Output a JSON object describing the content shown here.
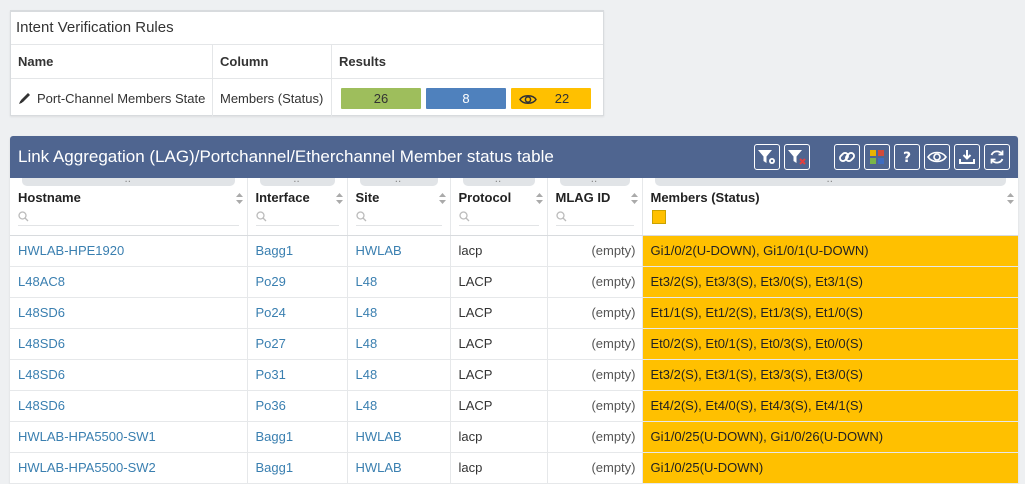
{
  "intent_rules": {
    "title": "Intent Verification Rules",
    "headers": {
      "name": "Name",
      "column": "Column",
      "results": "Results"
    },
    "rule": {
      "name": "Port-Channel Members State",
      "column": "Members (Status)",
      "results": {
        "green": "26",
        "blue": "8",
        "orange": "22"
      }
    }
  },
  "table": {
    "title": "Link Aggregation (LAG)/Portchannel/Etherchannel Member status table",
    "toolbar_icons": [
      "filter-settings-icon",
      "filter-clear-icon",
      "link-icon",
      "color-grid-icon",
      "help-icon",
      "eye-icon",
      "download-icon",
      "refresh-icon"
    ],
    "columns": [
      "Hostname",
      "Interface",
      "Site",
      "Protocol",
      "MLAG ID",
      "Members (Status)"
    ],
    "rows": [
      {
        "hostname": "HWLAB-HPE1920",
        "interface": "Bagg1",
        "site": "HWLAB",
        "protocol": "lacp",
        "mlag": "(empty)",
        "members": "Gi1/0/2(U-DOWN), Gi1/0/1(U-DOWN)"
      },
      {
        "hostname": "L48AC8",
        "interface": "Po29",
        "site": "L48",
        "protocol": "LACP",
        "mlag": "(empty)",
        "members": "Et3/2(S), Et3/3(S), Et3/0(S), Et3/1(S)"
      },
      {
        "hostname": "L48SD6",
        "interface": "Po24",
        "site": "L48",
        "protocol": "LACP",
        "mlag": "(empty)",
        "members": "Et1/1(S), Et1/2(S), Et1/3(S), Et1/0(S)"
      },
      {
        "hostname": "L48SD6",
        "interface": "Po27",
        "site": "L48",
        "protocol": "LACP",
        "mlag": "(empty)",
        "members": "Et0/2(S), Et0/1(S), Et0/3(S), Et0/0(S)"
      },
      {
        "hostname": "L48SD6",
        "interface": "Po31",
        "site": "L48",
        "protocol": "LACP",
        "mlag": "(empty)",
        "members": "Et3/2(S), Et3/1(S), Et3/3(S), Et3/0(S)"
      },
      {
        "hostname": "L48SD6",
        "interface": "Po36",
        "site": "L48",
        "protocol": "LACP",
        "mlag": "(empty)",
        "members": "Et4/2(S), Et4/0(S), Et4/3(S), Et4/1(S)"
      },
      {
        "hostname": "HWLAB-HPA5500-SW1",
        "interface": "Bagg1",
        "site": "HWLAB",
        "protocol": "lacp",
        "mlag": "(empty)",
        "members": "Gi1/0/25(U-DOWN), Gi1/0/26(U-DOWN)"
      },
      {
        "hostname": "HWLAB-HPA5500-SW2",
        "interface": "Bagg1",
        "site": "HWLAB",
        "protocol": "lacp",
        "mlag": "(empty)",
        "members": "Gi1/0/25(U-DOWN)"
      }
    ]
  },
  "colors": {
    "header_bar": "#4f6590",
    "link": "#3a7fb0",
    "status_green": "#9ebe5c",
    "status_blue": "#4f81bd",
    "status_orange": "#ffc000"
  }
}
